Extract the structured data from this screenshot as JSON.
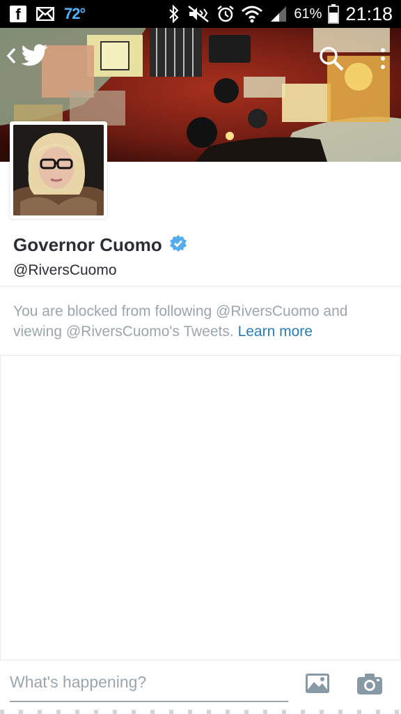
{
  "status_bar": {
    "temperature": "72°",
    "battery_percent": "61%",
    "time": "21:18",
    "icons": [
      "facebook-icon",
      "mail-icon",
      "bluetooth-icon",
      "mute-icon",
      "alarm-icon",
      "wifi-icon",
      "signal-icon",
      "battery-icon"
    ]
  },
  "header": {
    "icons": [
      "back-icon",
      "twitter-bird-icon",
      "search-icon",
      "overflow-menu-icon"
    ]
  },
  "profile": {
    "name": "Governor Cuomo",
    "verified": true,
    "handle": "@RiversCuomo"
  },
  "blocked_notice": {
    "text": "You are blocked from following @RiversCuomo and viewing @RiversCuomo's Tweets.",
    "link_label": "Learn more"
  },
  "compose": {
    "placeholder": "What's happening?",
    "icons": [
      "photo-icon",
      "camera-icon"
    ]
  },
  "colors": {
    "accent": "#2b7bb9",
    "verified_badge": "#55acee",
    "muted_text": "#9aa5ad",
    "temperature": "#4fb3ff"
  }
}
